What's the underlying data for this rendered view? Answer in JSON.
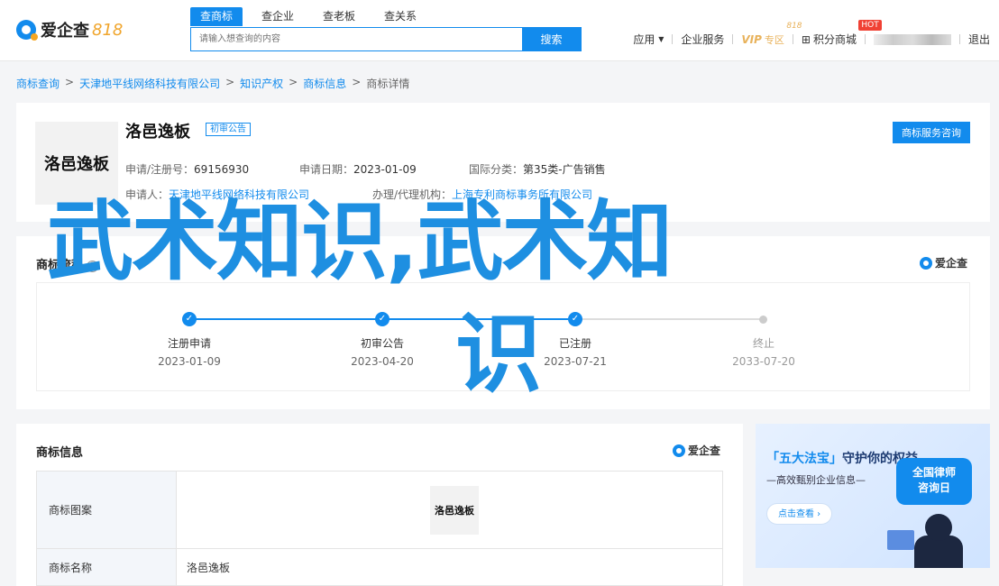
{
  "header": {
    "logo_text": "爱企查",
    "logo_num": "818",
    "tabs": [
      "查商标",
      "查企业",
      "查老板",
      "查关系"
    ],
    "search_placeholder": "请输入想查询的内容",
    "search_button": "搜索",
    "nav": {
      "app": "应用",
      "service": "企业服务",
      "vip": "VIP",
      "vip_zone": "专区",
      "vip_badge": "818",
      "points": "积分商城",
      "hot": "HOT",
      "logout": "退出"
    }
  },
  "breadcrumb": [
    "商标查询",
    "天津地平线网络科技有限公司",
    "知识产权",
    "商标信息",
    "商标详情"
  ],
  "summary": {
    "thumb_text": "洛邑逸板",
    "name": "洛邑逸板",
    "status": "初审公告",
    "consult_button": "商标服务咨询",
    "reg_no_label": "申请/注册号：",
    "reg_no": "69156930",
    "apply_date_label": "申请日期：",
    "apply_date": "2023-01-09",
    "class_label": "国际分类：",
    "class": "第35类-广告销售",
    "applicant_label": "申请人：",
    "applicant": "天津地平线网络科技有限公司",
    "agent_label": "办理/代理机构：",
    "agent": "上海专利商标事务所有限公司"
  },
  "process": {
    "title": "商标流程",
    "brand": "爱企查",
    "steps": [
      {
        "label": "注册申请",
        "date": "2023-01-09",
        "done": true
      },
      {
        "label": "初审公告",
        "date": "2023-04-20",
        "done": true
      },
      {
        "label": "已注册",
        "date": "2023-07-21",
        "done": true
      },
      {
        "label": "终止",
        "date": "2033-07-20",
        "done": false
      }
    ]
  },
  "detail": {
    "title": "商标信息",
    "brand": "爱企查",
    "rows": [
      {
        "label": "商标图案",
        "value": "洛邑逸板"
      },
      {
        "label": "商标名称",
        "value": "洛邑逸板"
      }
    ]
  },
  "ad": {
    "title_hl": "「五大法宝」",
    "title": "守护你的权益",
    "sub": "—高效甄别企业信息—",
    "bubble_line1": "全国律师",
    "bubble_line2": "咨询日",
    "button": "点击查看 ›"
  },
  "watermark": {
    "line1": "武术知识,武术知",
    "line2": "识"
  },
  "colors": {
    "accent": "#128bed",
    "watermark": "#1e8fe1"
  }
}
